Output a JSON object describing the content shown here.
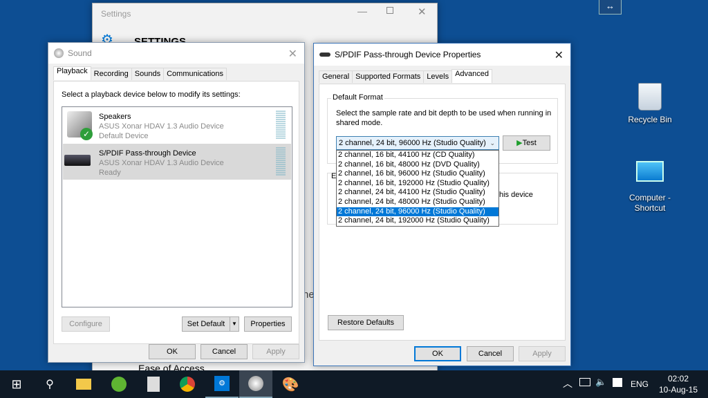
{
  "settings_window": {
    "title": "Settings",
    "heading": "SETTINGS",
    "partial_text": "he",
    "ease_of_access": "Ease of Access"
  },
  "sound_dialog": {
    "title": "Sound",
    "tabs": [
      "Playback",
      "Recording",
      "Sounds",
      "Communications"
    ],
    "instruction": "Select a playback device below to modify its settings:",
    "devices": [
      {
        "name": "Speakers",
        "driver": "ASUS Xonar HDAV 1.3 Audio Device",
        "status": "Default Device",
        "icon": "speaker-icon"
      },
      {
        "name": "S/PDIF Pass-through Device",
        "driver": "ASUS Xonar HDAV 1.3 Audio Device",
        "status": "Ready",
        "icon": "receiver-icon",
        "selected": true
      }
    ],
    "configure": "Configure",
    "set_default": "Set Default",
    "properties": "Properties",
    "ok": "OK",
    "cancel": "Cancel",
    "apply": "Apply"
  },
  "spdif_dialog": {
    "title": "S/PDIF Pass-through Device Properties",
    "tabs": [
      "General",
      "Supported Formats",
      "Levels",
      "Advanced"
    ],
    "default_format_label": "Default Format",
    "description": "Select the sample rate and bit depth to be used when running in shared mode.",
    "selected_format": "2 channel, 24 bit, 96000 Hz (Studio Quality)",
    "test": "Test",
    "options": [
      "2 channel, 16 bit, 44100 Hz (CD Quality)",
      "2 channel, 16 bit, 48000 Hz (DVD Quality)",
      "2 channel, 16 bit, 96000 Hz (Studio Quality)",
      "2 channel, 16 bit, 192000 Hz (Studio Quality)",
      "2 channel, 24 bit, 44100 Hz (Studio Quality)",
      "2 channel, 24 bit, 48000 Hz (Studio Quality)",
      "2 channel, 24 bit, 96000 Hz (Studio Quality)",
      "2 channel, 24 bit, 192000 Hz (Studio Quality)"
    ],
    "selected_index": 6,
    "hidden_group_letter": "E",
    "hidden_text": "his device",
    "restore_defaults": "Restore Defaults",
    "ok": "OK",
    "cancel": "Cancel",
    "apply": "Apply"
  },
  "desktop": {
    "icons": [
      {
        "label": "Recycle Bin"
      },
      {
        "label": "Computer - Shortcut"
      }
    ]
  },
  "taskbar": {
    "language": "ENG",
    "time": "02:02",
    "date": "10-Aug-15"
  },
  "colors": {
    "desktop": "#0d4e93",
    "accent": "#0078d7",
    "taskbar": "#0f1a26"
  }
}
